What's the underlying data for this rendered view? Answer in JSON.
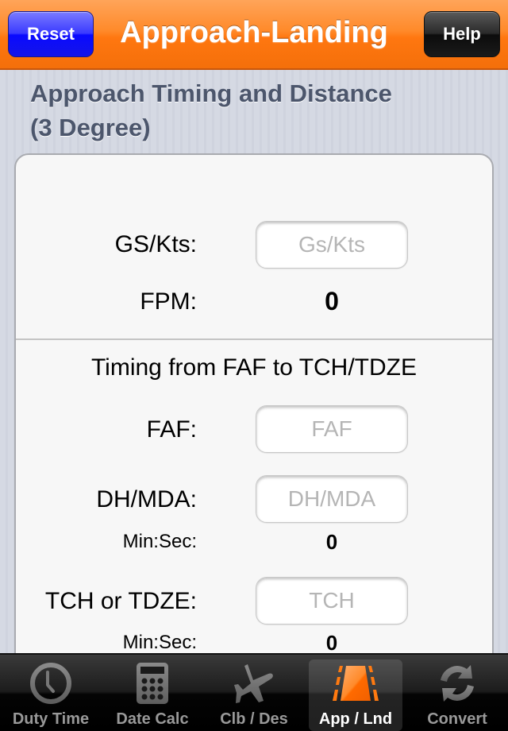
{
  "navbar": {
    "title": "Approach-Landing",
    "reset_label": "Reset",
    "help_label": "Help"
  },
  "section": {
    "title_line1": "Approach Timing and Distance",
    "title_line2": "(3 Degree)"
  },
  "form": {
    "gs_label": "GS/Kts:",
    "gs_placeholder": "Gs/Kts",
    "gs_value": "",
    "fpm_label": "FPM:",
    "fpm_value": "0",
    "timing_heading": "Timing from FAF to TCH/TDZE",
    "faf_label": "FAF:",
    "faf_placeholder": "FAF",
    "faf_value": "",
    "dhmda_label": "DH/MDA:",
    "dhmda_placeholder": "DH/MDA",
    "dhmda_value": "",
    "dhmda_minsec_label": "Min:Sec:",
    "dhmda_minsec_value": "0",
    "tch_label": "TCH or TDZE:",
    "tch_placeholder": "TCH",
    "tch_value": "",
    "tch_minsec_label": "Min:Sec:",
    "tch_minsec_value": "0"
  },
  "tabbar": {
    "active": "App / Lnd",
    "accent_color": "#ff7a10",
    "items": [
      {
        "label": "Duty Time",
        "icon": "clock-icon"
      },
      {
        "label": "Date Calc",
        "icon": "calculator-icon"
      },
      {
        "label": "Clb / Des",
        "icon": "airplane-icon"
      },
      {
        "label": "App / Lnd",
        "icon": "runway-icon"
      },
      {
        "label": "Convert",
        "icon": "refresh-icon"
      }
    ]
  },
  "colors": {
    "navbar_orange": "#ff7a10",
    "reset_blue": "#1a1aff",
    "help_black": "#1a1a1a",
    "section_text": "#4c566c"
  }
}
